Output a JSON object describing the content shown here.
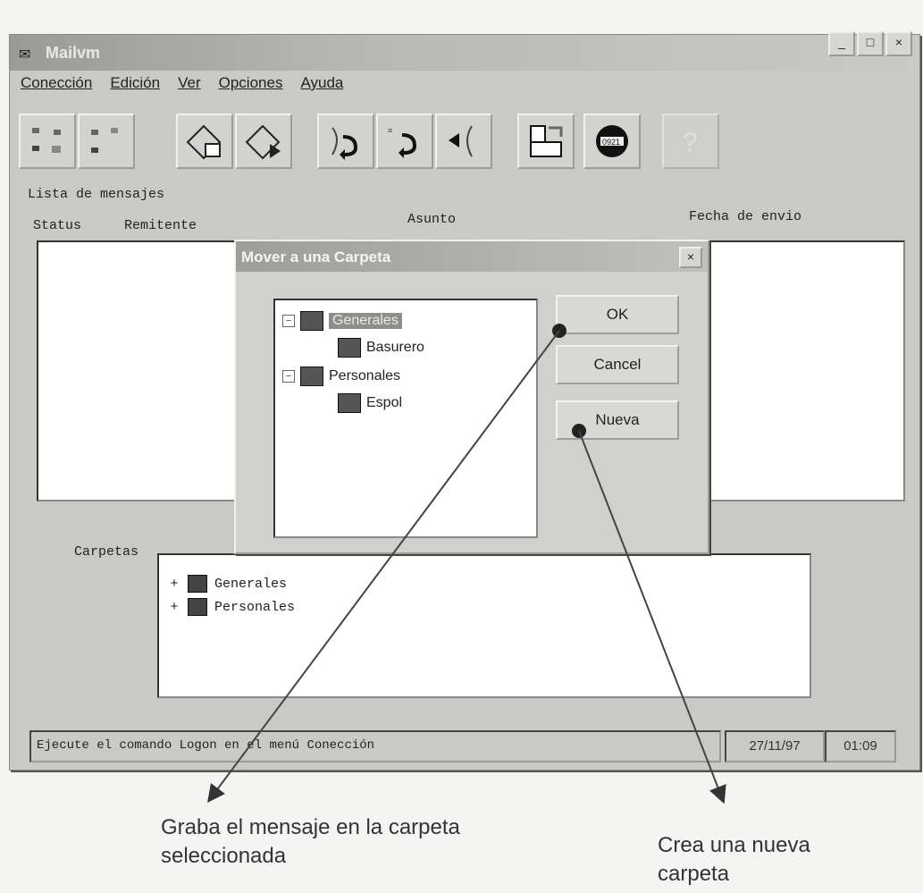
{
  "window": {
    "title": "Mailvm",
    "controls": [
      "_",
      "□",
      "×"
    ]
  },
  "menu": [
    "Conección",
    "Edición",
    "Ver",
    "Opciones",
    "Ayuda"
  ],
  "toolbar": {
    "buttons": [
      "connect-icon",
      "disconnect-icon",
      "read-mail-icon",
      "send-mail-icon",
      "reply-icon",
      "reply-all-icon",
      "forward-icon",
      "move-folder-icon",
      "clock-icon",
      "help-icon"
    ],
    "clock_text": "0921"
  },
  "message_list": {
    "label": "Lista de mensajes",
    "columns": [
      "Status",
      "Remitente",
      "Asunto",
      "Fecha de envio"
    ]
  },
  "folders": {
    "label": "Carpetas",
    "items": [
      "Generales",
      "Personales"
    ]
  },
  "statusbar": {
    "text": "Ejecute el comando Logon en el menú Conección",
    "date": "27/11/97",
    "time": "01:09"
  },
  "dialog": {
    "title": "Mover a una Carpeta",
    "close": "×",
    "tree": {
      "generales": "Generales",
      "basurero": "Basurero",
      "personales": "Personales",
      "espol": "Espol"
    },
    "buttons": {
      "ok": "OK",
      "cancel": "Cancel",
      "nueva": "Nueva"
    }
  },
  "annotations": {
    "left": "Graba el mensaje en la carpeta seleccionada",
    "right": "Crea una nueva carpeta"
  }
}
